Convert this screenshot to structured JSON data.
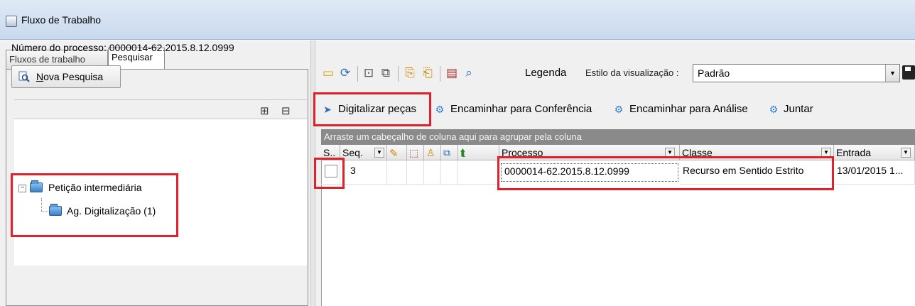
{
  "window": {
    "title": "Fluxo de Trabalho"
  },
  "left_panel": {
    "tabs": [
      {
        "label": "Fluxos de trabalho",
        "active": false
      },
      {
        "label": "Pesquisar",
        "active": true
      }
    ],
    "process_number_label": "Número do processo: 0000014-62.2015.8.12.0999",
    "new_search_button": {
      "underlined_char": "N",
      "rest": "ova Pesquisa"
    },
    "tree": {
      "root": {
        "label": "Petição intermediária",
        "expander": "−"
      },
      "child": {
        "label": "Ag. Digitalização (1)"
      }
    }
  },
  "toolbar": {
    "legend_label": "Legenda",
    "view_style_label": "Estilo da visualização :",
    "view_style_value": "Padrão"
  },
  "actions": [
    {
      "label": "Digitalizar peças"
    },
    {
      "label": "Encaminhar para Conferência"
    },
    {
      "label": "Encaminhar para Análise"
    },
    {
      "label": "Juntar"
    }
  ],
  "grid": {
    "group_hint": "Arraste um cabeçalho de coluna aqui para agrupar pela coluna",
    "columns": [
      "S..",
      "Seq.",
      "Processo",
      "Classe",
      "Entrada"
    ],
    "rows": [
      {
        "seq": "3",
        "processo": "0000014-62.2015.8.12.0999",
        "classe": "Recurso em Sentido Estrito",
        "entrada": "13/01/2015 1..."
      }
    ]
  },
  "colors": {
    "highlight": "#e0202a",
    "titlebar": "#c9d9ee",
    "group_bar": "#8a8a8a"
  }
}
